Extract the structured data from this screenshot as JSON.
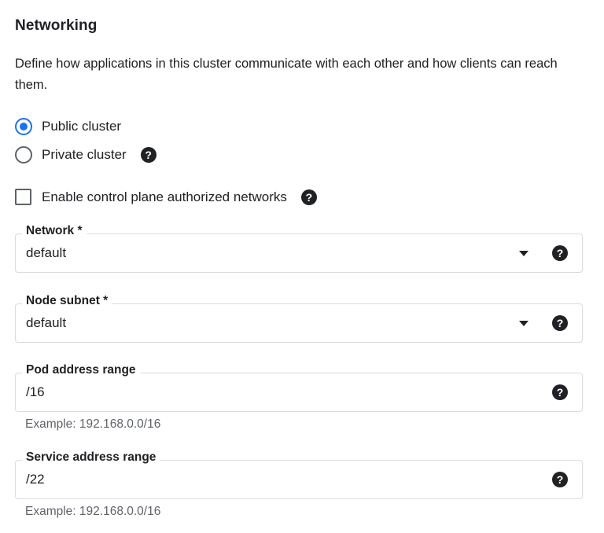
{
  "section": {
    "title": "Networking",
    "description": "Define how applications in this cluster communicate with each other and how clients can reach them."
  },
  "cluster_type": {
    "options": [
      {
        "label": "Public cluster",
        "selected": true
      },
      {
        "label": "Private cluster",
        "selected": false
      }
    ]
  },
  "authorized_networks": {
    "label": "Enable control plane authorized networks",
    "checked": false
  },
  "network": {
    "label": "Network *",
    "value": "default"
  },
  "node_subnet": {
    "label": "Node subnet *",
    "value": "default"
  },
  "pod_address_range": {
    "label": "Pod address range",
    "value": "/16",
    "hint": "Example: 192.168.0.0/16"
  },
  "service_address_range": {
    "label": "Service address range",
    "value": "/22",
    "hint": "Example: 192.168.0.0/16"
  },
  "help_icon_glyph": "?",
  "colors": {
    "accent": "#1a73e8",
    "text": "#202124",
    "hint": "#5f6368",
    "border": "#dadce0"
  }
}
